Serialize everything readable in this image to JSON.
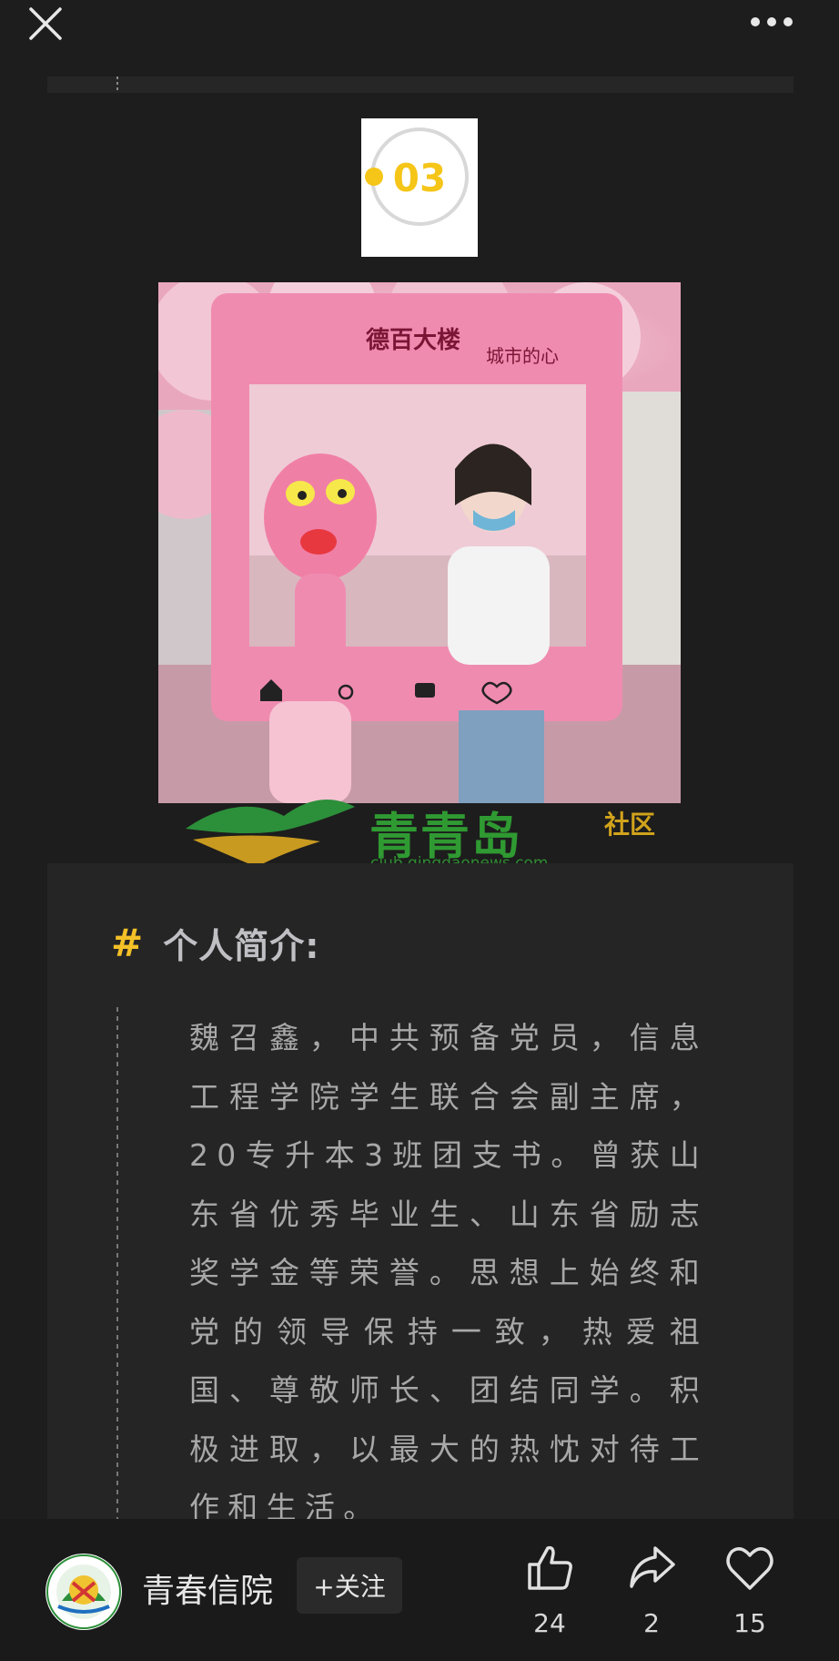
{
  "header": {
    "close_icon": "close-icon",
    "more_icon": "more-horizontal-icon"
  },
  "badge": {
    "number": "03",
    "accent_color": "#f5c518"
  },
  "photo": {
    "frame_brand": "德百大楼",
    "frame_slogan": "城市的心"
  },
  "watermark": {
    "title": "青青岛",
    "club": "社区",
    "url": "club.qingdaonews.com"
  },
  "intro": {
    "hash": "#",
    "heading": "个人简介:",
    "body": "魏召鑫，中共预备党员，信息工程学院学生联合会副主席，20专升本3班团支书。曾获山东省优秀毕业生、山东省励志奖学金等荣誉。思想上始终和党的领导保持一致，热爱祖国、尊敬师长、团结同学。积极进取，以最大的热忱对待工作和生活。"
  },
  "footer": {
    "account_name": "青春信院",
    "follow_label": "+关注",
    "like_count": "24",
    "share_count": "2",
    "favorite_count": "15"
  },
  "colors": {
    "background": "#1d1d1d",
    "card": "#252525",
    "accent": "#f3c027"
  }
}
